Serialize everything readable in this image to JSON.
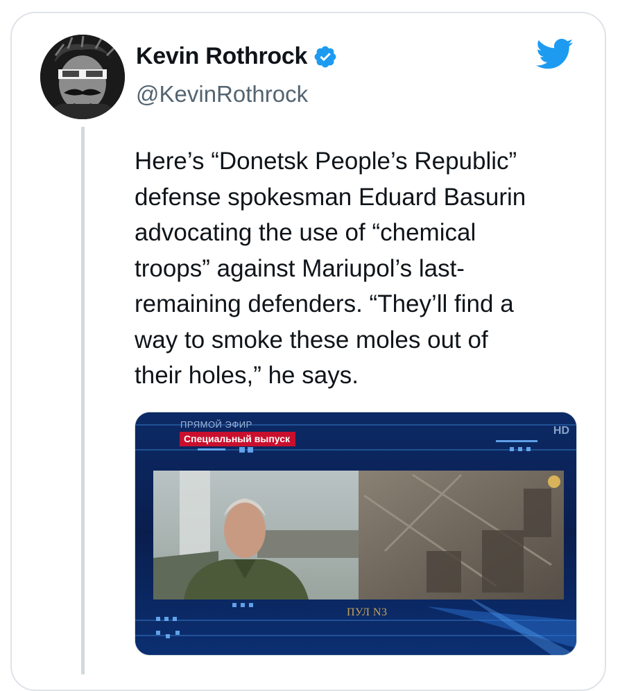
{
  "tweet": {
    "author_name": "Kevin Rothrock",
    "handle": "@KevinRothrock",
    "verified": true,
    "text": "Here’s “Donetsk People’s Republic”\ndefense spokesman Eduard Basurin\nadvocating the use of “chemical\ntroops” against Mariupol’s last-\nremaining defenders. “They’ll find a\nway to smoke these moles out of\ntheir holes,” he says.",
    "avatar_icon": "avatar-image",
    "brand_icon": "twitter-bird-icon"
  },
  "media": {
    "live_label": "ПРЯМОЙ ЭФИР",
    "special_label": "Специальный выпуск",
    "hd_label": "HD",
    "pool_label": "ПУЛ N3"
  },
  "colors": {
    "twitter_blue": "#1d9bf0",
    "text_primary": "#0f1419",
    "text_secondary": "#536471",
    "border": "#cfd9de"
  }
}
